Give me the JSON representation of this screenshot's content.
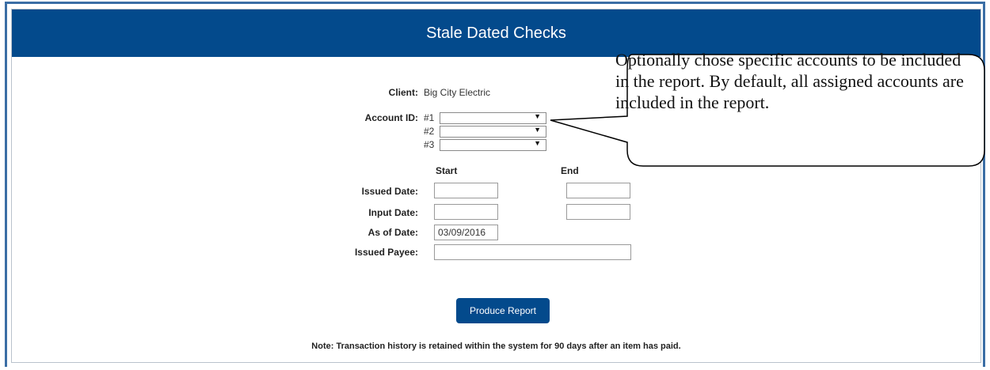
{
  "header": {
    "title": "Stale Dated Checks"
  },
  "form": {
    "client_label": "Client:",
    "client_value": "Big City Electric",
    "account_label": "Account ID:",
    "accounts": [
      {
        "label": "#1",
        "value": ""
      },
      {
        "label": "#2",
        "value": ""
      },
      {
        "label": "#3",
        "value": ""
      }
    ],
    "col_start": "Start",
    "col_end": "End",
    "issued_date_label": "Issued Date:",
    "input_date_label": "Input Date:",
    "as_of_date_label": "As of Date:",
    "as_of_date_value": "03/09/2016",
    "issued_payee_label": "Issued Payee:",
    "issued_payee_value": ""
  },
  "actions": {
    "produce_report_label": "Produce Report"
  },
  "note": "Note: Transaction history is retained within the system for 90 days after an item has paid.",
  "callout": {
    "text": "Optionally chose specific accounts to be included in the report.  By default, all assigned accounts are included in the report."
  },
  "colors": {
    "header_bg": "#034a8c",
    "button_bg": "#034a8c",
    "frame_border": "#3b6ea5"
  }
}
